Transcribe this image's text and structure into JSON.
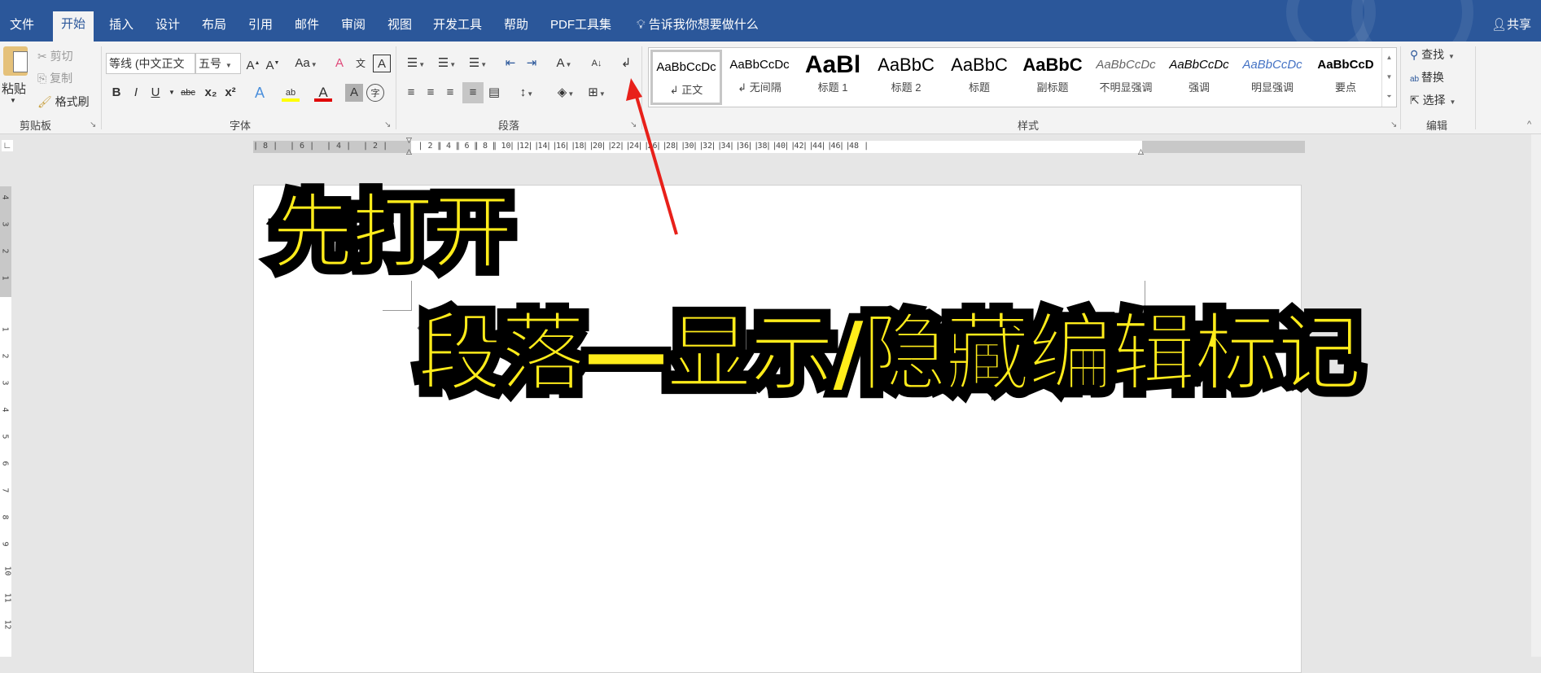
{
  "tabs": [
    "文件",
    "开始",
    "插入",
    "设计",
    "布局",
    "引用",
    "邮件",
    "审阅",
    "视图",
    "开发工具",
    "帮助",
    "PDF工具集"
  ],
  "active_tab": "开始",
  "tell_me": "告诉我你想要做什么",
  "share": "共享",
  "clipboard": {
    "paste": "粘贴",
    "cut": "剪切",
    "copy": "复制",
    "format_painter": "格式刷",
    "label": "剪贴板"
  },
  "font": {
    "name": "等线 (中文正文",
    "size": "五号",
    "label": "字体",
    "change_case": "Aa",
    "bold": "B",
    "italic": "I",
    "underline": "U",
    "strike": "abc",
    "sub": "x₂",
    "sup": "x²"
  },
  "paragraph": {
    "label": "段落"
  },
  "styles": {
    "label": "样式",
    "items": [
      {
        "preview": "AaBbCcDc",
        "name": "↲ 正文"
      },
      {
        "preview": "AaBbCcDc",
        "name": "↲ 无间隔"
      },
      {
        "preview": "AaBl",
        "name": "标题 1"
      },
      {
        "preview": "AaBbC",
        "name": "标题 2"
      },
      {
        "preview": "AaBbC",
        "name": "标题"
      },
      {
        "preview": "AaBbC",
        "name": "副标题"
      },
      {
        "preview": "AaBbCcDc",
        "name": "不明显强调"
      },
      {
        "preview": "AaBbCcDc",
        "name": "强调"
      },
      {
        "preview": "AaBbCcDc",
        "name": "明显强调"
      },
      {
        "preview": "AaBbCcD",
        "name": "要点"
      }
    ]
  },
  "editing": {
    "find": "查找",
    "replace": "替换",
    "select": "选择",
    "label": "编辑"
  },
  "ruler": {
    "left": [
      "8",
      "6",
      "4",
      "2"
    ],
    "right": [
      "2",
      "4",
      "6",
      "8",
      "10",
      "12",
      "14",
      "16",
      "18",
      "20",
      "22",
      "24",
      "26",
      "28",
      "30",
      "32",
      "34",
      "36",
      "38",
      "40",
      "42",
      "44",
      "46",
      "48"
    ]
  },
  "vruler": [
    "4",
    "3",
    "2",
    "1",
    "1",
    "2",
    "3",
    "4",
    "5",
    "6",
    "7",
    "8",
    "9",
    "10",
    "11",
    "12"
  ],
  "document": {
    "line1": "先打开",
    "line2": "段落—显示/隐藏编辑标记",
    "para_mark": "↵"
  },
  "colors": {
    "accent": "#2b579a",
    "highlight": "#ffec1a",
    "arrow": "#e8201a"
  }
}
